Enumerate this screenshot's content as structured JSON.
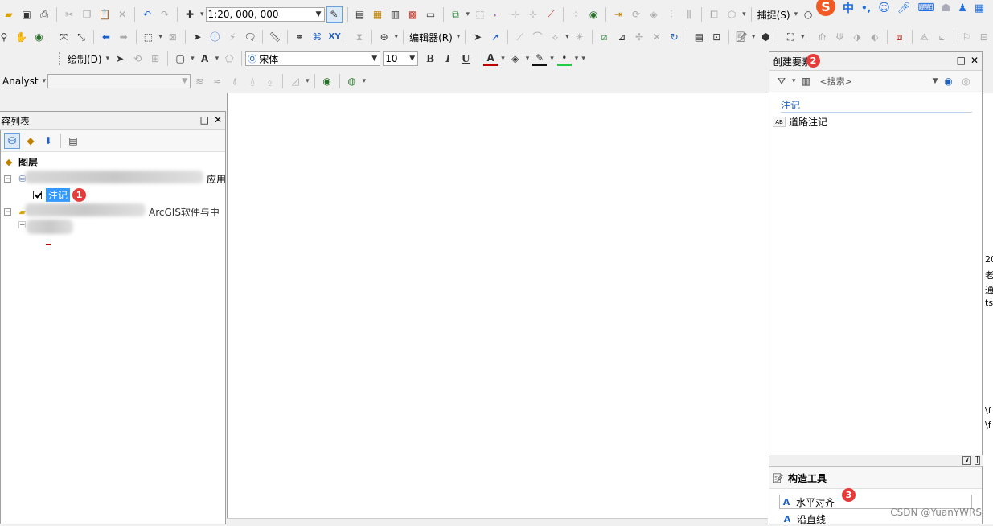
{
  "toolbar1": {
    "scale_value": "1:20, 000, 000",
    "snap_label": "捕捉(S)"
  },
  "toolbar2": {
    "editor_label": "编辑器(R)"
  },
  "toolbar3": {
    "draw_label": "绘制(D)",
    "font_name": "宋体",
    "font_size": "10",
    "bold": "B",
    "italic": "I",
    "underline": "U",
    "font_color_letter": "A"
  },
  "toolbar4": {
    "analyst_label": "Analyst"
  },
  "ime": {
    "logo": "S",
    "mode": "中",
    "punct": "•,"
  },
  "toc": {
    "title": "容列表",
    "root_label": "图层",
    "group1_suffix": "应用",
    "layer_label": "注记",
    "group2_text": "ArcGIS软件与中"
  },
  "create_features": {
    "title": "创建要素",
    "search_placeholder": "<搜索>",
    "group_label": "注记",
    "template_label": "道路注记",
    "template_icon_text": "AB"
  },
  "construction": {
    "title": "构造工具",
    "tool1": "水平对齐",
    "tool2": "沿直线"
  },
  "badges": [
    "1",
    "2",
    "3"
  ],
  "right_edge_texts": [
    "20",
    "老",
    "通",
    "ts",
    "\\f",
    "\\f"
  ],
  "watermark": "CSDN @YuanYWRS",
  "colors": {
    "selection": "#3399ff",
    "badge": "#e63b3b",
    "ime_blue": "#1f6fe0"
  }
}
